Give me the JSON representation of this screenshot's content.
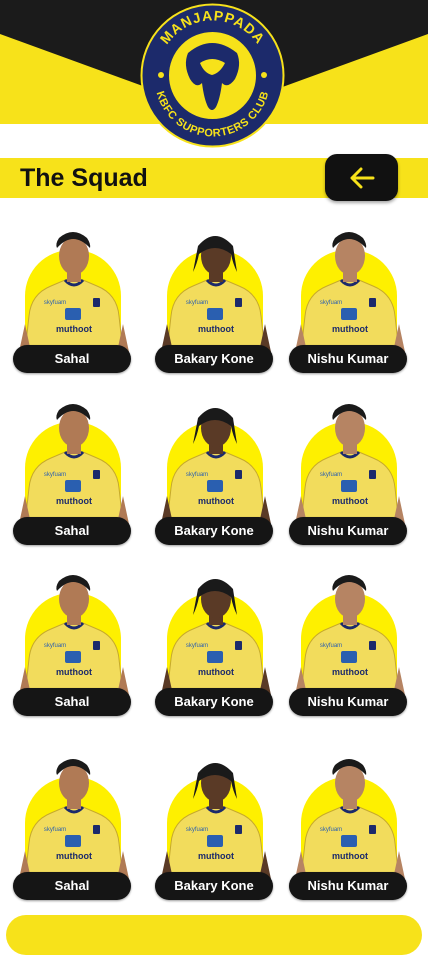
{
  "brand": {
    "logo_top_text": "MANJAPPADA",
    "logo_bottom_text": "KBFC SUPPORTERS CLUB",
    "primary_color": "#f7e21a",
    "dark_color": "#151515"
  },
  "page": {
    "title": "The Squad",
    "back_icon": "arrow-left-icon"
  },
  "squad": [
    [
      {
        "name": "Sahal"
      },
      {
        "name": "Bakary Kone"
      },
      {
        "name": "Nishu Kumar"
      }
    ],
    [
      {
        "name": "Sahal"
      },
      {
        "name": "Bakary Kone"
      },
      {
        "name": "Nishu Kumar"
      }
    ],
    [
      {
        "name": "Sahal"
      },
      {
        "name": "Bakary Kone"
      },
      {
        "name": "Nishu Kumar"
      }
    ],
    [
      {
        "name": "Sahal"
      },
      {
        "name": "Bakary Kone"
      },
      {
        "name": "Nishu Kumar"
      }
    ]
  ],
  "jersey": {
    "sponsor_top": "skyfuam",
    "sponsor_main": "muthoot"
  }
}
